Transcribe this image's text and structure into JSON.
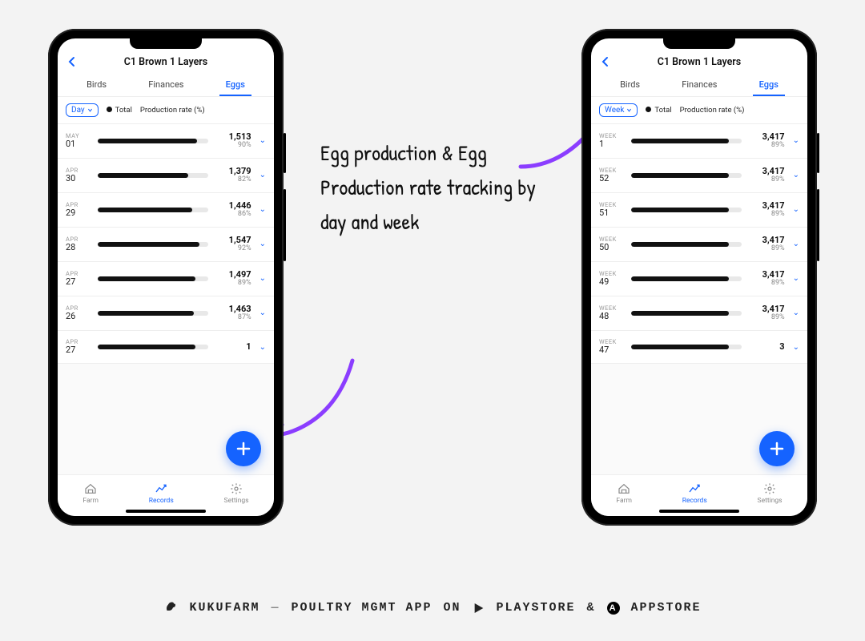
{
  "annotation": "Egg production & Egg Production rate tracking by day and week",
  "footer": {
    "brand": "KUKUFARM",
    "separator": "—",
    "tagline": "POULTRY MGMT APP",
    "on": "ON",
    "playstore": "PLAYSTORE",
    "amp": "&",
    "appstore": "APPSTORE"
  },
  "colors": {
    "accent": "#1563ff",
    "arrow": "#8b3dff"
  },
  "phoneLeft": {
    "title": "C1 Brown 1 Layers",
    "tabs": {
      "birds": "Birds",
      "finances": "Finances",
      "eggs": "Eggs"
    },
    "filter": {
      "period": "Day",
      "totalLabel": "Total",
      "rateLabel": "Production rate (%)"
    },
    "rows": [
      {
        "month": "MAY",
        "day": "01",
        "value": "1,513",
        "pct": "90%",
        "fill": 90
      },
      {
        "month": "APR",
        "day": "30",
        "value": "1,379",
        "pct": "82%",
        "fill": 82
      },
      {
        "month": "APR",
        "day": "29",
        "value": "1,446",
        "pct": "86%",
        "fill": 86
      },
      {
        "month": "APR",
        "day": "28",
        "value": "1,547",
        "pct": "92%",
        "fill": 92
      },
      {
        "month": "APR",
        "day": "27",
        "value": "1,497",
        "pct": "89%",
        "fill": 89
      },
      {
        "month": "APR",
        "day": "26",
        "value": "1,463",
        "pct": "87%",
        "fill": 87
      },
      {
        "month": "APR",
        "day": "27",
        "value": "1",
        "pct": "",
        "fill": 89
      }
    ],
    "nav": {
      "farm": "Farm",
      "records": "Records",
      "settings": "Settings"
    }
  },
  "phoneRight": {
    "title": "C1 Brown 1 Layers",
    "tabs": {
      "birds": "Birds",
      "finances": "Finances",
      "eggs": "Eggs"
    },
    "filter": {
      "period": "Week",
      "totalLabel": "Total",
      "rateLabel": "Production rate (%)"
    },
    "rows": [
      {
        "month": "WEEK",
        "day": "1",
        "value": "3,417",
        "pct": "89%",
        "fill": 89
      },
      {
        "month": "WEEK",
        "day": "52",
        "value": "3,417",
        "pct": "89%",
        "fill": 89
      },
      {
        "month": "WEEK",
        "day": "51",
        "value": "3,417",
        "pct": "89%",
        "fill": 89
      },
      {
        "month": "WEEK",
        "day": "50",
        "value": "3,417",
        "pct": "89%",
        "fill": 89
      },
      {
        "month": "WEEK",
        "day": "49",
        "value": "3,417",
        "pct": "89%",
        "fill": 89
      },
      {
        "month": "WEEK",
        "day": "48",
        "value": "3,417",
        "pct": "89%",
        "fill": 89
      },
      {
        "month": "WEEK",
        "day": "47",
        "value": "3",
        "pct": "",
        "fill": 89
      }
    ],
    "nav": {
      "farm": "Farm",
      "records": "Records",
      "settings": "Settings"
    }
  }
}
